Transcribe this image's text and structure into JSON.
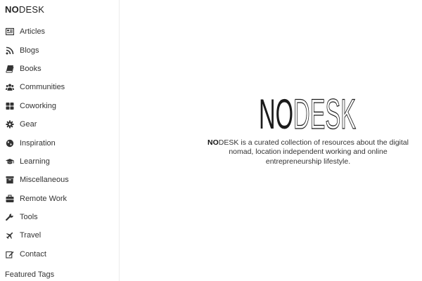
{
  "sidebar": {
    "brand_bold": "NO",
    "brand_rest": "DESK",
    "items": [
      {
        "label": "Articles",
        "icon": "newspaper-icon"
      },
      {
        "label": "Blogs",
        "icon": "rss-icon"
      },
      {
        "label": "Books",
        "icon": "book-icon"
      },
      {
        "label": "Communities",
        "icon": "users-icon"
      },
      {
        "label": "Coworking",
        "icon": "grid-icon"
      },
      {
        "label": "Gear",
        "icon": "gear-icon"
      },
      {
        "label": "Inspiration",
        "icon": "globe-icon"
      },
      {
        "label": "Learning",
        "icon": "graduation-cap-icon"
      },
      {
        "label": "Miscellaneous",
        "icon": "archive-icon"
      },
      {
        "label": "Remote Work",
        "icon": "briefcase-icon"
      },
      {
        "label": "Tools",
        "icon": "wrench-icon"
      },
      {
        "label": "Travel",
        "icon": "plane-icon"
      },
      {
        "label": "Contact",
        "icon": "edit-icon"
      }
    ],
    "featured_tags_label": "Featured Tags"
  },
  "main": {
    "logo_bold": "NO",
    "logo_rest": "DESK",
    "desc_bold": "NO",
    "desc_line1_rest": "DESK is a curated collection of resources about the digital",
    "desc_line2": "nomad, location independent working and online",
    "desc_line3": "entrepreneurship lifestyle."
  }
}
